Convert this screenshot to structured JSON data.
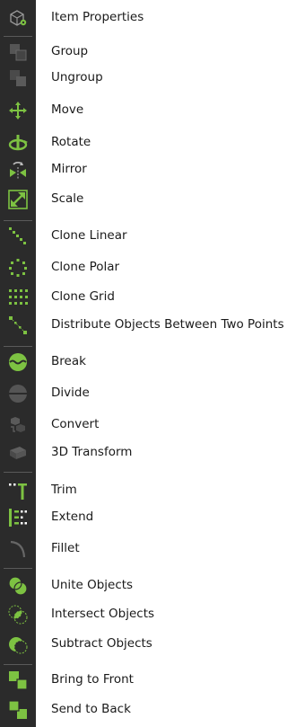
{
  "menu": {
    "items": [
      {
        "label": "Item Properties",
        "icon": "item-properties-icon"
      },
      {
        "label": "Group",
        "icon": "group-icon"
      },
      {
        "label": "Ungroup",
        "icon": "ungroup-icon"
      },
      {
        "label": "Move",
        "icon": "move-icon"
      },
      {
        "label": "Rotate",
        "icon": "rotate-icon"
      },
      {
        "label": "Mirror",
        "icon": "mirror-icon"
      },
      {
        "label": "Scale",
        "icon": "scale-icon"
      },
      {
        "label": "Clone Linear",
        "icon": "clone-linear-icon"
      },
      {
        "label": "Clone Polar",
        "icon": "clone-polar-icon"
      },
      {
        "label": "Clone Grid",
        "icon": "clone-grid-icon"
      },
      {
        "label": "Distribute Objects Between Two Points",
        "icon": "distribute-objects-icon"
      },
      {
        "label": "Break",
        "icon": "break-icon"
      },
      {
        "label": "Divide",
        "icon": "divide-icon"
      },
      {
        "label": "Convert",
        "icon": "convert-icon"
      },
      {
        "label": "3D Transform",
        "icon": "3d-transform-icon"
      },
      {
        "label": "Trim",
        "icon": "trim-icon"
      },
      {
        "label": "Extend",
        "icon": "extend-icon"
      },
      {
        "label": "Fillet",
        "icon": "fillet-icon"
      },
      {
        "label": "Unite Objects",
        "icon": "unite-objects-icon"
      },
      {
        "label": "Intersect Objects",
        "icon": "intersect-objects-icon"
      },
      {
        "label": "Subtract Objects",
        "icon": "subtract-objects-icon"
      },
      {
        "label": "Bring to Front",
        "icon": "bring-to-front-icon"
      },
      {
        "label": "Send to Back",
        "icon": "send-to-back-icon"
      }
    ]
  },
  "colors": {
    "accent": "#7dc242",
    "strip": "#2b2b2b",
    "disabled": "#555555"
  }
}
